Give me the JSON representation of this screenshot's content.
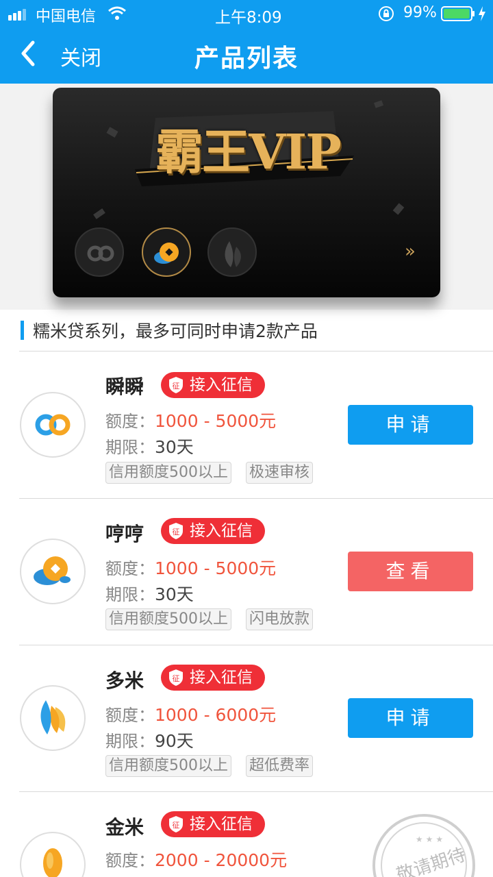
{
  "status_bar": {
    "carrier": "中国电信",
    "time": "上午8:09",
    "battery": "99%",
    "battery_level": 0.99
  },
  "header": {
    "back_label": "关闭",
    "title": "产品列表"
  },
  "banner": {
    "title": "霸王VIP",
    "icons": [
      "infinity-logo",
      "coin-logo",
      "petal-logo"
    ],
    "active_index": 1,
    "next_glyph": "»"
  },
  "section": {
    "title": "糯米贷系列，最多可同时申请2款产品"
  },
  "products": [
    {
      "name": "瞬瞬",
      "badge": "接入征信",
      "badge_icon": "征",
      "amount_label": "额度：",
      "amount": "1000 - 5000元",
      "term_label": "期限：",
      "term": "30天",
      "tags": [
        "信用额度500以上",
        "极速审核"
      ],
      "action": "申请",
      "action_color": "#0f9df0",
      "logo": "infinity-logo"
    },
    {
      "name": "哼哼",
      "badge": "接入征信",
      "badge_icon": "征",
      "amount_label": "额度：",
      "amount": "1000 - 5000元",
      "term_label": "期限：",
      "term": "30天",
      "tags": [
        "信用额度500以上",
        "闪电放款"
      ],
      "action": "查看",
      "action_color": "#f46464",
      "logo": "coin-logo"
    },
    {
      "name": "多米",
      "badge": "接入征信",
      "badge_icon": "征",
      "amount_label": "额度：",
      "amount": "1000 - 6000元",
      "term_label": "期限：",
      "term": "90天",
      "tags": [
        "信用额度500以上",
        "超低费率"
      ],
      "action": "申请",
      "action_color": "#0f9df0",
      "logo": "petal-logo"
    },
    {
      "name": "金米",
      "badge": "接入征信",
      "badge_icon": "征",
      "amount_label": "额度：",
      "amount": "2000 - 20000元",
      "stamp": "敬请期待",
      "logo": "grain-logo"
    }
  ],
  "colors": {
    "primary": "#0f9df0",
    "badge_red": "#ef2f37",
    "amount_red": "#f0543c",
    "view_button": "#f46464"
  }
}
